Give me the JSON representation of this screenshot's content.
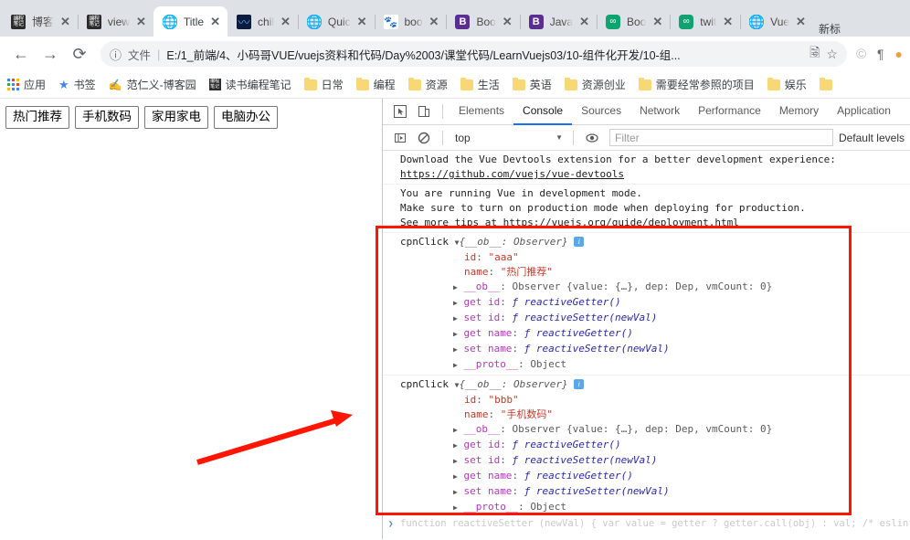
{
  "browser": {
    "tabs": [
      {
        "label": "博客",
        "icon": "note-icon",
        "active": false
      },
      {
        "label": "view",
        "icon": "note-icon",
        "active": false
      },
      {
        "label": "Title",
        "icon": "globe-icon",
        "active": true
      },
      {
        "label": "chil",
        "icon": "blue-wave-icon",
        "active": false
      },
      {
        "label": "Quic",
        "icon": "globe-icon",
        "active": false
      },
      {
        "label": "boo",
        "icon": "baidu-icon",
        "active": false
      },
      {
        "label": "Boo",
        "icon": "bilibili-b-icon",
        "active": false
      },
      {
        "label": "Java",
        "icon": "bilibili-b-icon",
        "active": false
      },
      {
        "label": "Boo",
        "icon": "green-link-icon",
        "active": false
      },
      {
        "label": "twit",
        "icon": "green-link-icon",
        "active": false
      },
      {
        "label": "Vue",
        "icon": "globe-icon",
        "active": false
      }
    ],
    "new_tab_label": "新标",
    "close_label": "✕",
    "nav": {
      "back": "←",
      "forward": "→",
      "reload": "⟳"
    },
    "omnibox": {
      "info_icon": "info-circle-icon",
      "scheme_label": "文件",
      "separator": "|",
      "url": "E:/1_前端/4、小码哥VUE/vuejs资料和代码/Day%2003/课堂代码/LearnVuejs03/10-组件化开发/10-组...",
      "icons": [
        "translate-icon",
        "bookmark-star-icon"
      ]
    },
    "toolbar_icons": [
      "copyright-icon",
      "pilcrow-icon",
      "profile-icon"
    ],
    "bookmarks": [
      {
        "label": "应用",
        "icon": "apps-grid-icon"
      },
      {
        "label": "书签",
        "icon": "star-icon"
      },
      {
        "label": "范仁义-博客园",
        "icon": "pen-icon"
      },
      {
        "label": "读书编程笔记",
        "icon": "note-icon"
      },
      {
        "label": "日常",
        "icon": "folder-icon"
      },
      {
        "label": "编程",
        "icon": "folder-icon"
      },
      {
        "label": "资源",
        "icon": "folder-icon"
      },
      {
        "label": "生活",
        "icon": "folder-icon"
      },
      {
        "label": "英语",
        "icon": "folder-icon"
      },
      {
        "label": "资源创业",
        "icon": "folder-icon"
      },
      {
        "label": "需要经常参照的项目",
        "icon": "folder-icon"
      },
      {
        "label": "娱乐",
        "icon": "folder-icon"
      },
      {
        "label": "",
        "icon": "folder-icon"
      }
    ]
  },
  "page": {
    "buttons": [
      "热门推荐",
      "手机数码",
      "家用家电",
      "电脑办公"
    ]
  },
  "devtools": {
    "left_icons": [
      "inspect-element-icon",
      "device-toolbar-icon"
    ],
    "tabs": [
      {
        "label": "Elements",
        "selected": false
      },
      {
        "label": "Console",
        "selected": true
      },
      {
        "label": "Sources",
        "selected": false
      },
      {
        "label": "Network",
        "selected": false
      },
      {
        "label": "Performance",
        "selected": false
      },
      {
        "label": "Memory",
        "selected": false
      },
      {
        "label": "Application",
        "selected": false
      }
    ],
    "filterbar": {
      "sidebar_icon": "console-sidebar-icon",
      "clear_icon": "clear-console-icon",
      "context": "top",
      "caret": "▼",
      "eye_icon": "live-expression-icon",
      "filter_placeholder": "Filter",
      "levels_label": "Default levels"
    },
    "console": {
      "messages": [
        {
          "lines": [
            "Download the Vue Devtools extension for a better development experience:",
            "https://github.com/vuejs/vue-devtools"
          ],
          "link_index": 1
        },
        {
          "lines": [
            "You are running Vue in development mode.",
            "Make sure to turn on production mode when deploying for production.",
            "See more tips at https://vuejs.org/guide/deployment.html"
          ],
          "link_index": -1
        }
      ],
      "groups": [
        {
          "label": "cpnClick",
          "triangle": "▼",
          "header": "{__ob__: Observer}",
          "info_badge": "i",
          "props": [
            {
              "expander": "",
              "key": "id",
              "sep": ": ",
              "value": "\"aaa\"",
              "style": "string"
            },
            {
              "expander": "",
              "key": "name",
              "sep": ": ",
              "value": "\"热门推荐\"",
              "style": "string"
            },
            {
              "expander": "▶",
              "key": "__ob__",
              "sep": ": ",
              "value": "Observer {value: {…}, dep: Dep, vmCount: 0}",
              "style": "plain"
            },
            {
              "expander": "▶",
              "key": "get id",
              "sep": ": ",
              "value": "ƒ reactiveGetter()",
              "style": "fn"
            },
            {
              "expander": "▶",
              "key": "set id",
              "sep": ": ",
              "value": "ƒ reactiveSetter(newVal)",
              "style": "fn"
            },
            {
              "expander": "▶",
              "key": "get name",
              "sep": ": ",
              "value": "ƒ reactiveGetter()",
              "style": "fn"
            },
            {
              "expander": "▶",
              "key": "set name",
              "sep": ": ",
              "value": "ƒ reactiveSetter(newVal)",
              "style": "fn"
            },
            {
              "expander": "▶",
              "key": "__proto__",
              "sep": ": ",
              "value": "Object",
              "style": "plain"
            }
          ]
        },
        {
          "label": "cpnClick",
          "triangle": "▼",
          "header": "{__ob__: Observer}",
          "info_badge": "i",
          "props": [
            {
              "expander": "",
              "key": "id",
              "sep": ": ",
              "value": "\"bbb\"",
              "style": "string"
            },
            {
              "expander": "",
              "key": "name",
              "sep": ": ",
              "value": "\"手机数码\"",
              "style": "string"
            },
            {
              "expander": "▶",
              "key": "__ob__",
              "sep": ": ",
              "value": "Observer {value: {…}, dep: Dep, vmCount: 0}",
              "style": "plain"
            },
            {
              "expander": "▶",
              "key": "get id",
              "sep": ": ",
              "value": "ƒ reactiveGetter()",
              "style": "fn"
            },
            {
              "expander": "▶",
              "key": "set id",
              "sep": ": ",
              "value": "ƒ reactiveSetter(newVal)",
              "style": "fn"
            },
            {
              "expander": "▶",
              "key": "get name",
              "sep": ": ",
              "value": "ƒ reactiveGetter()",
              "style": "fn"
            },
            {
              "expander": "▶",
              "key": "set name",
              "sep": ": ",
              "value": "ƒ reactiveSetter(newVal)",
              "style": "fn"
            },
            {
              "expander": "▶",
              "key": "__proto__",
              "sep": ": ",
              "value": "Object",
              "style": "plain"
            }
          ]
        }
      ],
      "prompt": {
        "caret": "❯",
        "ghost_text": "function reactiveSetter (newVal) { var value = getter ? getter.call(obj) : val; /* eslint-disable no-self-compare */ if (newVal === value || (newVal !== newVal && value !== value)) { return } /* eslint-enable no-self-compare */ if (customSetter) { customSetter(); } // #7981: for accessor properties without setter if (gette"
      }
    }
  },
  "annotations": {
    "highlight_box_color": "#ff1500",
    "arrow_color": "#ff1500"
  }
}
